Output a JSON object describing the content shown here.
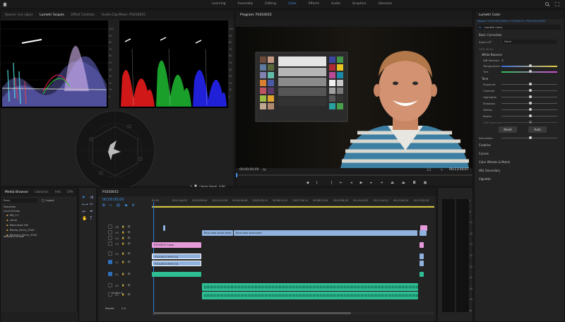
{
  "workspaces": [
    "Learning",
    "Assembly",
    "Editing",
    "Color",
    "Effects",
    "Audio",
    "Graphics",
    "Libraries"
  ],
  "active_workspace": "Color",
  "scopes": {
    "tabs": [
      "Source: (no clips)",
      "Lumetri Scopes",
      "Effect Controls",
      "Audio Clip Mixer: P1010015"
    ],
    "active_tab": "Lumetri Scopes",
    "waveform_ticks": [
      "100",
      "90",
      "80",
      "70",
      "60",
      "50",
      "40",
      "30",
      "20",
      "10",
      "0"
    ],
    "parade_ticks": [
      "100",
      "90",
      "80",
      "70",
      "60",
      "50",
      "40",
      "30",
      "20",
      "10",
      "0"
    ],
    "footer": {
      "clamp_label": "Clamp Signal",
      "bit_depth": "8 Bit"
    }
  },
  "program": {
    "title": "Program: P1010015",
    "timecode_in": "00;00;00;00",
    "fit_label": "Fit",
    "page": "1/1",
    "timecode_out": "00;13;59;07",
    "colors": {
      "timecode": "#3d8ee6"
    }
  },
  "lumetri": {
    "title": "Lumetri Color",
    "breadcrumb": "Master * P1010015.MOV  >  P1010015 * P1010015.MOV",
    "fx_badge": "fx",
    "preset": "Lumetri Color",
    "basic_correction": "Basic Correction",
    "input_lut_label": "Input LUT",
    "input_lut_value": "None",
    "hdr_white": "HDR White",
    "white_balance": "White Balance",
    "wb_selector": "WB Selector",
    "temperature": "Temperature",
    "tint": "Tint",
    "tone": "Tone",
    "tone_rows": [
      "Exposure",
      "Contrast",
      "Highlights",
      "Shadows",
      "Whites",
      "Blacks"
    ],
    "hdr_specular": "HDR Specular",
    "reset": "Reset",
    "auto": "Auto",
    "saturation": "Saturation",
    "sections": [
      "Creative",
      "Curves",
      "Color Wheels & Match",
      "HSL Secondary",
      "Vignette"
    ]
  },
  "media": {
    "tabs": [
      "Media Browser",
      "Libraries",
      "Info",
      "Effe"
    ],
    "active_tab": "Media Browser",
    "filter": "Sony",
    "view_label": "Ingest",
    "favorites": "Favorites",
    "local_drives": "Local Drives",
    "drives": [
      "HD_C1",
      "LaCie",
      "Macintosh HD",
      "Media_Drive_2020",
      "Rumsmi_Drive_2020"
    ],
    "network_drives": "Network Drives"
  },
  "timeline": {
    "title": "P1010015",
    "timecode": "00;00;00;00",
    "ruler": [
      "00;00",
      "00;01;04;02",
      "00;02;08;04",
      "00;03;12;06",
      "00;04;16;08",
      "00;05;20;10",
      "00;06;24;12",
      "00;07;28;14",
      "00;08;32;16",
      "00;09;36;18",
      "00;10;40;20",
      "00;11;44;22",
      "00;12;48;24",
      "00;13;52;26"
    ],
    "video_tracks": [
      "V6",
      "V5",
      "V4",
      "V3",
      "V2",
      "V1"
    ],
    "audio_tracks": [
      "A1",
      "A2",
      "A3"
    ],
    "audio_4_label": "Audio 4",
    "master_label": "Master",
    "master_value": "0.0",
    "clips": {
      "text1": "Runs rose vinkla reset",
      "text2": "Runs rose vinkunanti",
      "adjust": "P1010015 Layer",
      "v1a": "P1010015.MOV [V]",
      "v1b": "P1010015.MOV [V]"
    },
    "colors": {
      "video": "#8fb1de",
      "pink": "#e59ad9",
      "audio": "#2fbd93",
      "playhead": "#2d7fe0"
    }
  },
  "meters": {
    "scale": [
      "0",
      "-6",
      "-12",
      "-18",
      "-24",
      "-30",
      "-36",
      "-42",
      "-48",
      "-54",
      "dB"
    ]
  }
}
